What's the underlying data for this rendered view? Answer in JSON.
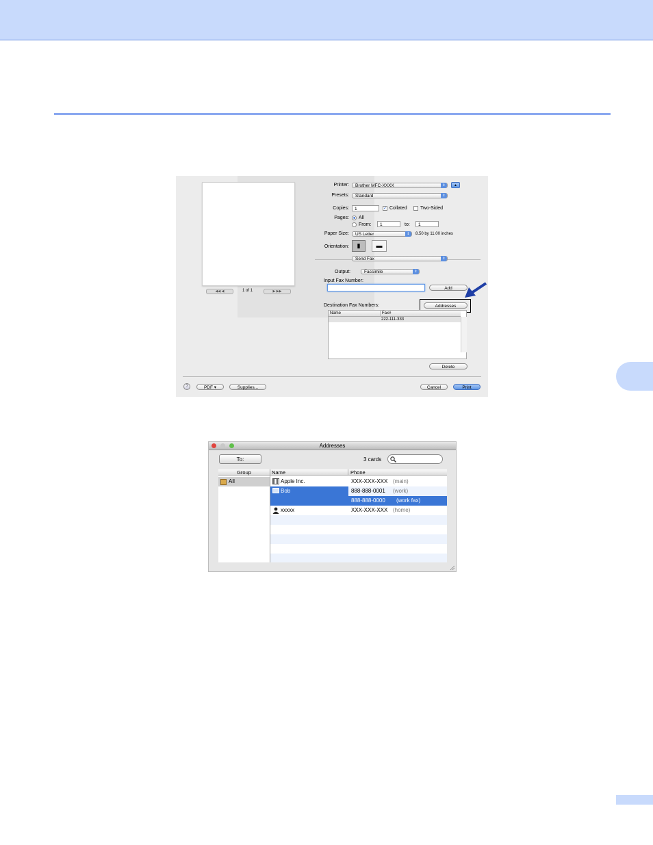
{
  "print_dialog": {
    "page_nav_label": "1 of 1",
    "nav_first_prev": "◀◀  ◀",
    "nav_next_last": "▶  ▶▶",
    "printer_label": "Printer:",
    "printer_value": "Brother MFC-XXXX",
    "presets_label": "Presets:",
    "presets_value": "Standard",
    "copies_label": "Copies:",
    "copies_value": "1",
    "collated_label": "Collated",
    "collated_checked": true,
    "two_sided_label": "Two-Sided",
    "two_sided_checked": false,
    "pages_label": "Pages:",
    "pages_all_label": "All",
    "pages_from_label": "From:",
    "pages_from_value": "1",
    "pages_to_label": "to:",
    "pages_to_value": "1",
    "paper_size_label": "Paper Size:",
    "paper_size_value": "US Letter",
    "paper_size_dims": "8.50 by 11.00 inches",
    "orientation_label": "Orientation:",
    "section_value": "Send Fax",
    "output_label": "Output:",
    "output_value": "Facsimile",
    "input_fax_label": "Input Fax Number:",
    "input_fax_value": "",
    "add_button": "Add",
    "dest_fax_label": "Destination Fax Numbers:",
    "addresses_button": "Addresses",
    "col_name": "Name",
    "col_fax": "Fax#",
    "dest_rows": [
      {
        "name": "",
        "fax": "222-111-333"
      }
    ],
    "delete_button": "Delete",
    "help_button": "?",
    "pdf_button": "PDF ▾",
    "supplies_button": "Supplies...",
    "cancel_button": "Cancel",
    "print_button": "Print"
  },
  "addresses_window": {
    "title": "Addresses",
    "to_button": "To:",
    "cards_count": "3 cards",
    "search_placeholder": "",
    "col_group": "Group",
    "col_name": "Name",
    "col_phone": "Phone",
    "group_all": "All",
    "rows": [
      {
        "name": "Apple Inc.",
        "phone": "XXX-XXX-XXX",
        "phone_type": "(main)"
      },
      {
        "name": "Bob",
        "phone": "888-888-0001",
        "phone_type": "(work)"
      },
      {
        "name": "",
        "phone": "888-888-0000",
        "phone_type": "(work fax)"
      },
      {
        "name": "xxxxx",
        "phone": "XXX-XXX-XXX",
        "phone_type": "(home)"
      }
    ]
  },
  "colors": {
    "header_band": "#c8dafc",
    "rule": "#8aa8f0",
    "selection": "#3a76d6",
    "callout_arrow": "#1f3fa6"
  }
}
